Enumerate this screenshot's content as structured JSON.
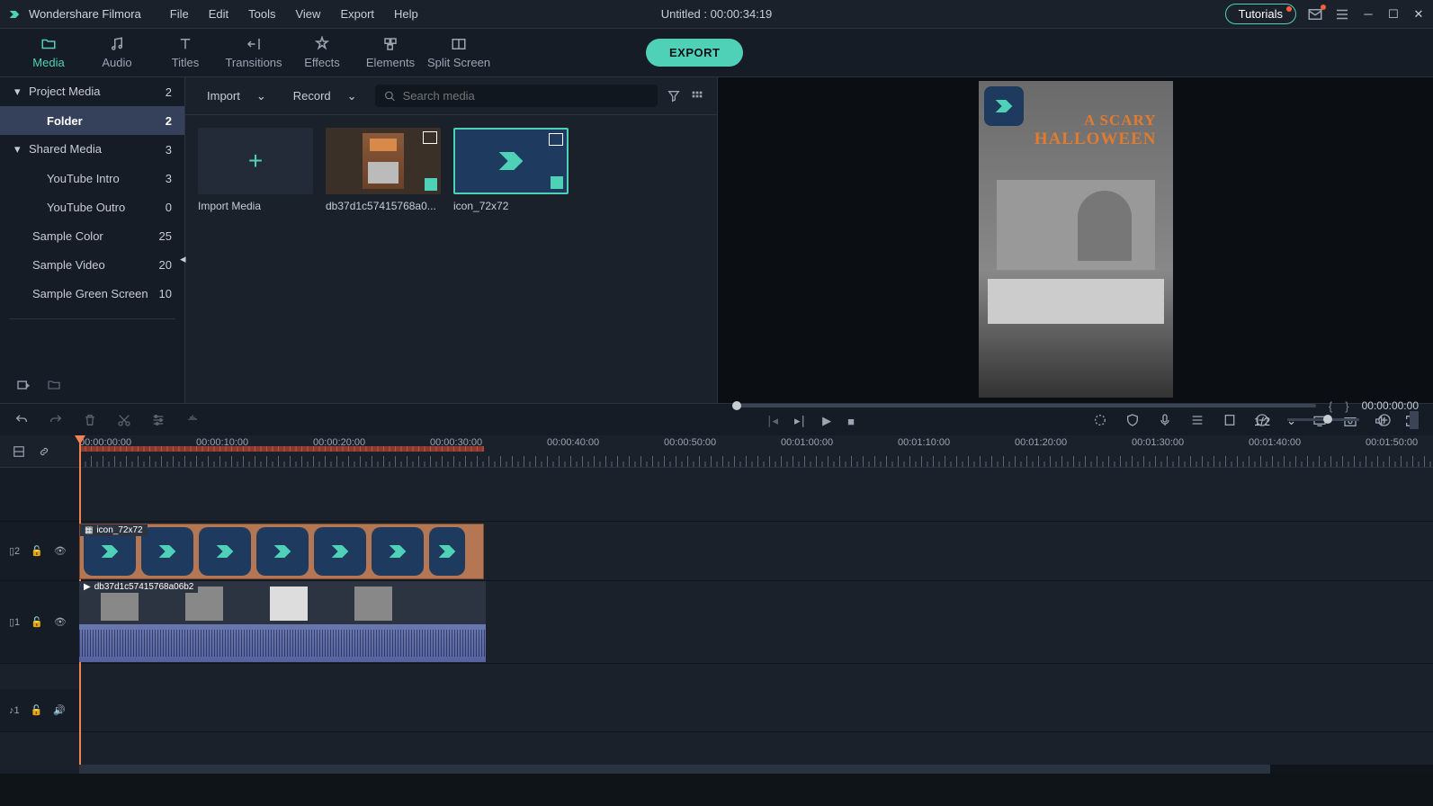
{
  "app": {
    "name": "Wondershare Filmora",
    "project_title": "Untitled : 00:00:34:19"
  },
  "menubar": [
    "File",
    "Edit",
    "Tools",
    "View",
    "Export",
    "Help"
  ],
  "titlebar_right": {
    "tutorials": "Tutorials"
  },
  "toptabs": [
    {
      "id": "media",
      "label": "Media",
      "active": true
    },
    {
      "id": "audio",
      "label": "Audio"
    },
    {
      "id": "titles",
      "label": "Titles"
    },
    {
      "id": "transitions",
      "label": "Transitions"
    },
    {
      "id": "effects",
      "label": "Effects"
    },
    {
      "id": "elements",
      "label": "Elements"
    },
    {
      "id": "split",
      "label": "Split Screen"
    }
  ],
  "export_label": "EXPORT",
  "sidebar": {
    "items": [
      {
        "label": "Project Media",
        "count": "2",
        "caret": true
      },
      {
        "label": "Folder",
        "count": "2",
        "selected": true
      },
      {
        "label": "Shared Media",
        "count": "3",
        "caret": true
      },
      {
        "label": "YouTube Intro",
        "count": "3",
        "child": true
      },
      {
        "label": "YouTube Outro",
        "count": "0",
        "child": true
      },
      {
        "label": "Sample Color",
        "count": "25",
        "child": false,
        "indent": true
      },
      {
        "label": "Sample Video",
        "count": "20",
        "child": false,
        "indent": true
      },
      {
        "label": "Sample Green Screen",
        "count": "10",
        "child": false,
        "indent": true
      }
    ]
  },
  "mediapanel": {
    "import_label": "Import",
    "record_label": "Record",
    "search_placeholder": "Search media",
    "import_tile": "Import Media",
    "thumbs": [
      {
        "name": "db37d1c57415768a0..."
      },
      {
        "name": "icon_72x72",
        "selected": true
      }
    ]
  },
  "preview": {
    "overlay1": "A SCARY",
    "overlay2": "HALLOWEEN",
    "ratio": "1/2",
    "time": "00:00:00:00",
    "brace_open": "{",
    "brace_close": "}"
  },
  "ruler_ticks": [
    "00:00:00:00",
    "00:00:10:00",
    "00:00:20:00",
    "00:00:30:00",
    "00:00:40:00",
    "00:00:50:00",
    "00:01:00:00",
    "00:01:10:00",
    "00:01:20:00",
    "00:01:30:00",
    "00:01:40:00",
    "00:01:50:00"
  ],
  "tracks": {
    "pip_label": "icon_72x72",
    "main_label": "db37d1c57415768a06b2",
    "pip_head": "▯2",
    "main_head": "▯1",
    "audio_head": "♪1"
  }
}
